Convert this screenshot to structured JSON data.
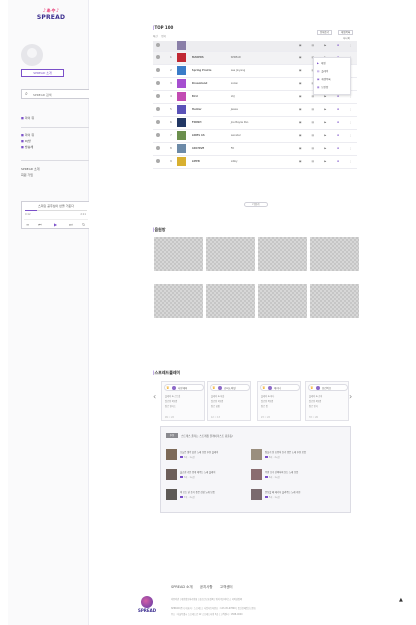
{
  "brand": {
    "mark": "♪ぁゃ♪",
    "name": "SPREAD"
  },
  "sidebar": {
    "intro_button": "SPREAD 소개",
    "search_placeholder": "SPREAD 검색",
    "links_a": [
      "마이 뮤"
    ],
    "links_b": [
      "마이 뮤",
      "DJ방",
      "방송채"
    ],
    "links_c": [
      "SPREAD 소개",
      "회원 가입"
    ]
  },
  "player": {
    "title": "스피릿 공주님이 반을 거둔다",
    "time_current": "0:12",
    "time_total": "2:11",
    "progress": 0.2,
    "controls": [
      "≡",
      "⏮",
      "▶",
      "⏭",
      "↻"
    ]
  },
  "chart_section": {
    "title": "TOP 100",
    "tabs": [
      "최신",
      "인기"
    ],
    "buttons": [
      "전체듣기",
      "재생목록"
    ],
    "right_label": "하나의",
    "actions": [
      "▣",
      "▤",
      "▶",
      "✚",
      "⋮"
    ],
    "rows": [
      {
        "rank": "1",
        "song": "MAKERS",
        "artist": "SPREAD",
        "thumb": "#c02833"
      },
      {
        "rank": "2",
        "song": "Spring Prairie",
        "artist": "Lee Jinyang",
        "thumb": "#3a7cc8"
      },
      {
        "rank": "3",
        "song": "Dreamland",
        "artist": "Lozan",
        "thumb": "#a64fd0"
      },
      {
        "rank": "4",
        "song": "Bird",
        "artist": "LKJ",
        "thumb": "#c24bb3"
      },
      {
        "rank": "5",
        "song": "Hunter",
        "artist": "Jessie",
        "thumb": "#5a52b8"
      },
      {
        "rank": "6",
        "song": "FINISH",
        "artist": "Joe Baylie Pan",
        "thumb": "#223764"
      },
      {
        "rank": "7",
        "song": "LINES AS",
        "artist": "Leinster",
        "thumb": "#6b8f4d"
      },
      {
        "rank": "8",
        "song": "ARCHIVE",
        "artist": "FD",
        "thumb": "#6c8aa8"
      },
      {
        "rank": "9",
        "song": "LIEEB",
        "artist": "Libby",
        "thumb": "#d8b030"
      }
    ]
  },
  "popup": {
    "items": [
      "재생",
      "플레이",
      "재생목록",
      "보관함"
    ]
  },
  "more_button": "더보기",
  "grid_section": {
    "title": "음원방"
  },
  "dj_section": {
    "title": "스프레드플레이",
    "cards": [
      {
        "name": "나랑재미",
        "lines": [
          "플레이 ✿ 스트릿",
          "팔로워 2천명",
          "장르 발라드"
        ],
        "stats": "99 ♡ 22"
      },
      {
        "name": "슈퍼노바잇",
        "lines": [
          "플레이 ✿ 하슬",
          "팔로워 1천명",
          "장르 힙합"
        ],
        "stats": "12 ♡ 13"
      },
      {
        "name": "예지니",
        "lines": [
          "플레이 ✿ 미나",
          "팔로워 3천명",
          "장르 팝"
        ],
        "stats": "23 ♡ 22"
      },
      {
        "name": "유진이오",
        "lines": [
          "플레이 ✿ 초이",
          "팔로워 4천명",
          "장르 인디"
        ],
        "stats": "33 ♡ 26"
      }
    ],
    "arrow_left": "‹",
    "arrow_right": "›"
  },
  "playlist": {
    "tag": "추천",
    "title": "스트레스 풀리는 스트레칭 플레이리스트 총출동!",
    "items": [
      {
        "t1": "오늘은 생각 끝인 노래 모음 추천 플레이",
        "t2": "3곡 · 1시간"
      },
      {
        "t1": "잠들기 전 조용히 듣기 좋은 노래 추천 모음",
        "t2": "8곡 · 2시간"
      },
      {
        "t1": "출근길 기분 좋게 해주는 노래 플레이",
        "t2": "3곡 · 1시간"
      },
      {
        "t1": "주말 오후 산책하며 듣는 노래 모음",
        "t2": "6곡 · 1시간"
      },
      {
        "t1": "비 오는 날 듣기 좋은 감성 노래 모음",
        "t2": "7곡 · 2시간"
      },
      {
        "t1": "운동할 때 에너지 올려주는 노래 추천",
        "t2": "5곡 · 1시간"
      }
    ],
    "thumbs": [
      "#7d6a58",
      "#9a8e7e",
      "#6d5f5a",
      "#8a6c70",
      "#5e5a56",
      "#7a6a6e"
    ]
  },
  "footer": {
    "nav": [
      "SPREAD 소개",
      "공지사항",
      "고객센터"
    ],
    "line1": "이용약관  |  개인정보처리방침  |  청소년보호정책  |  위치기반서비스  |  저작권정책",
    "line2": "SPREAD(주)  |  대표자 : 스프레드  |  사업자등록번호 : 123-45-67890  |  통신판매업신고번호",
    "line3": "주소 : 서울특별시 스프레드로 12 스프레드타워 3층  |  고객센터 : 1588-0000",
    "logo_text": "SPREAD",
    "top_icon": "▲"
  },
  "colors": {
    "accent": "#7b50c9",
    "brand_pink": "#e8407a",
    "brand_navy": "#3b2d8f"
  }
}
